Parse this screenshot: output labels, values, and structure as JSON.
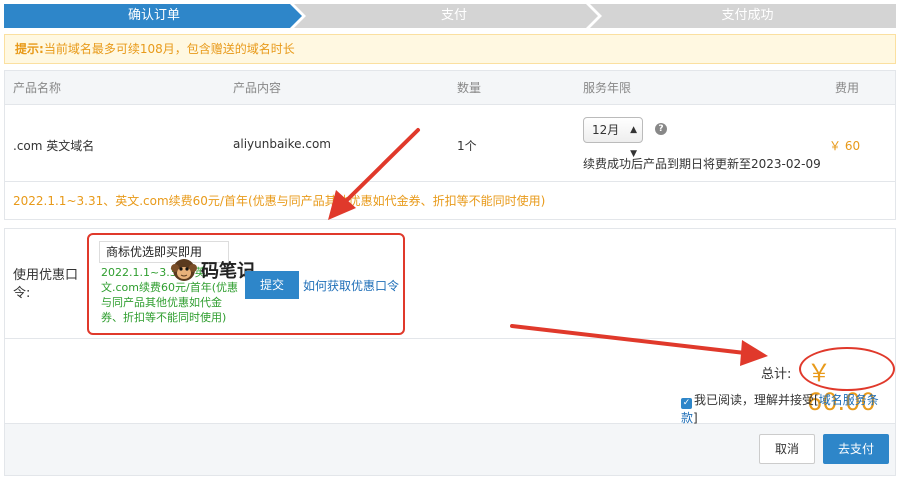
{
  "steps": [
    {
      "label": "确认订单",
      "active": true
    },
    {
      "label": "支付",
      "active": false
    },
    {
      "label": "支付成功",
      "active": false
    }
  ],
  "notice": {
    "prefix": "提示:",
    "text": "当前域名最多可续108月，包含赠送的域名时长"
  },
  "table": {
    "headers": [
      "产品名称",
      "产品内容",
      "数量",
      "服务年限",
      "费用"
    ],
    "row": {
      "product_name": ".com 英文域名",
      "product_content": "aliyunbaike.com",
      "quantity": "1个",
      "term_selected": "12月",
      "renew_note": "续费成功后产品到期日将更新至2023-02-09",
      "fee": "￥ 60"
    },
    "promo": "2022.1.1~3.31、英文.com续费60元/首年(优惠与同产品其他优惠如代金券、折扣等不能同时使用)"
  },
  "coupon": {
    "label": "使用优惠口令:",
    "input_value": "商标优选即买即用",
    "desc": "2022.1.1~3.31、英文.com续费60元/首年(优惠与同产品其他优惠如代金券、折扣等不能同时使用)",
    "watermark": "码笔记",
    "submit_label": "提交",
    "help_link": "如何获取优惠口令"
  },
  "total": {
    "label": "总计:",
    "amount": "￥ 60.00",
    "agree_text": "我已阅读，理解并接受[",
    "agree_link": "域名服务条款",
    "agree_close": "]"
  },
  "footer": {
    "cancel_label": "取消",
    "pay_label": "去支付"
  },
  "colors": {
    "active_step": "#2e86c9",
    "inactive_step": "#d4d4d4",
    "accent_orange": "#e89a1a",
    "annotation_red": "#e0392b",
    "promo_green": "#2f9e2f"
  }
}
